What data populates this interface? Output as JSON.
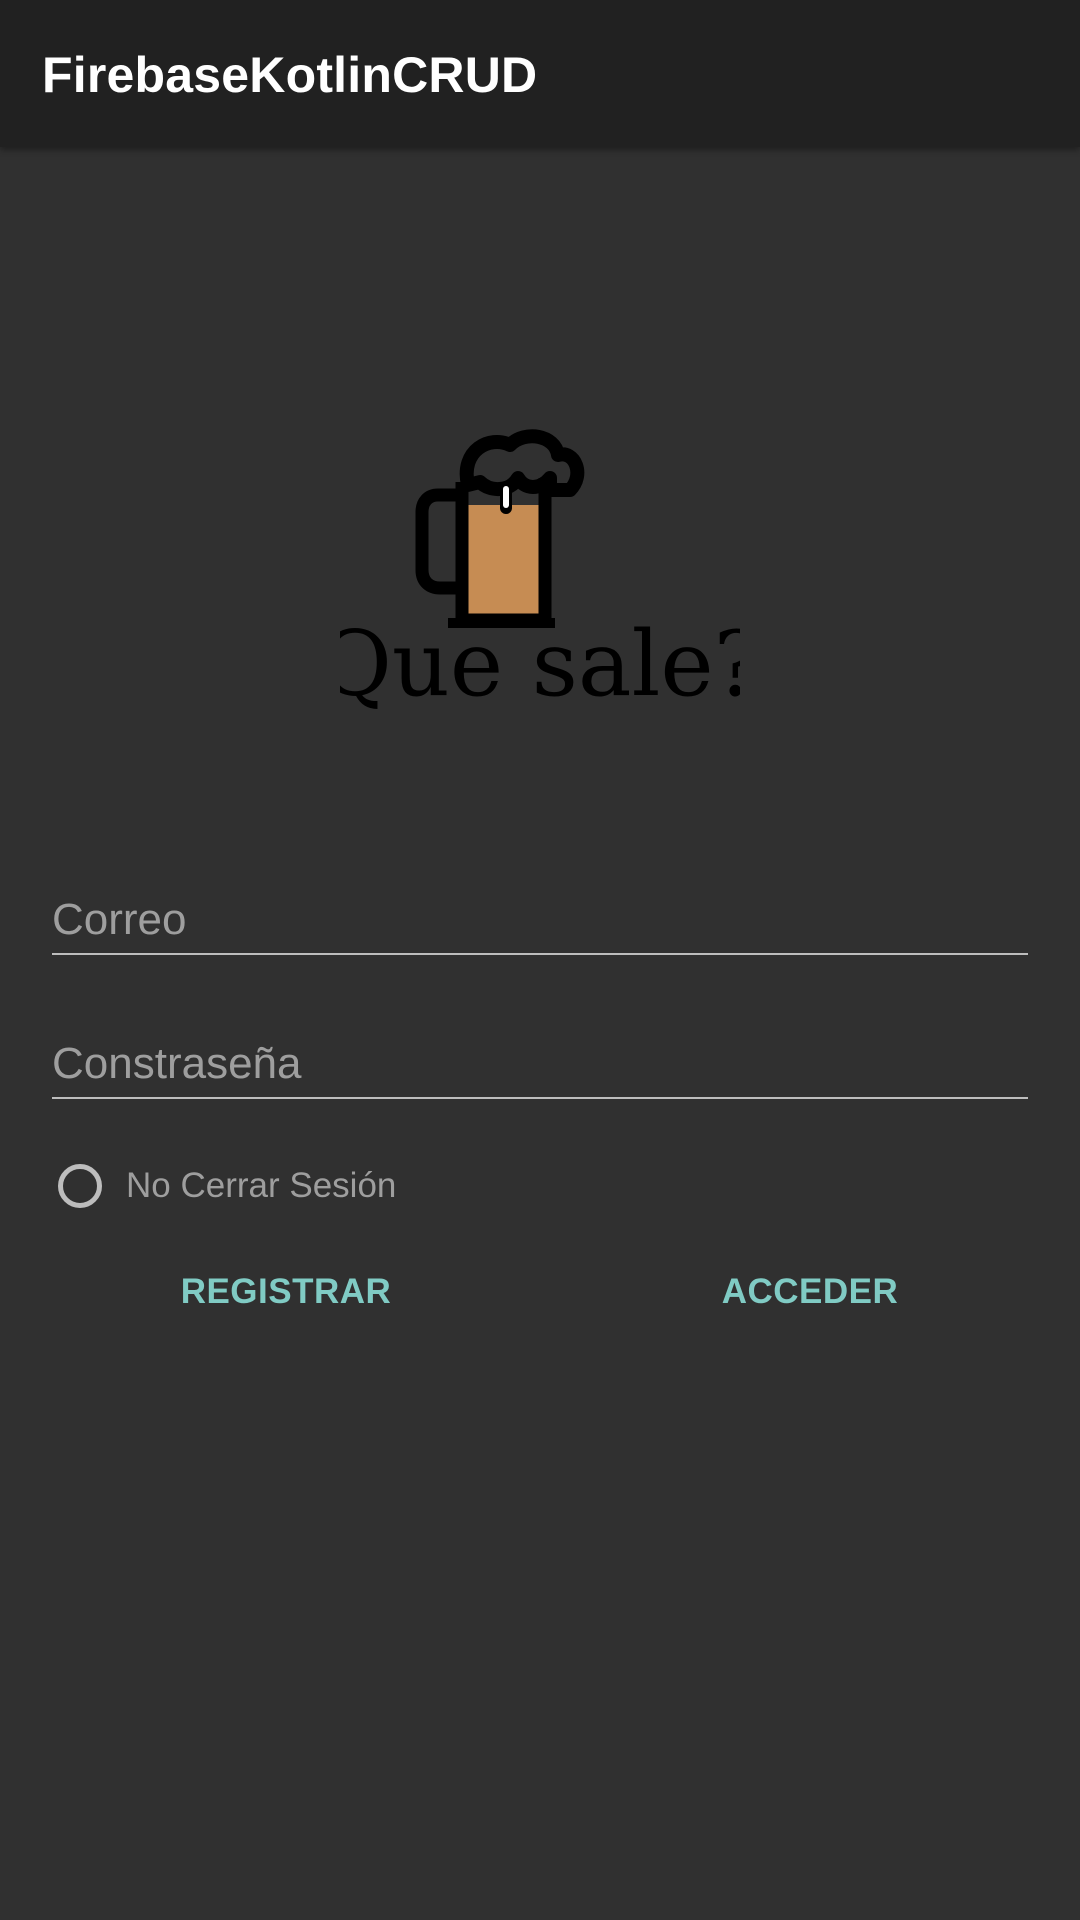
{
  "app_bar": {
    "title": "FirebaseKotlinCRUD"
  },
  "logo": {
    "icon": "beer-mug-icon",
    "text": "Que sale?",
    "colors": {
      "beer": "#c68c53",
      "outline": "#000000",
      "foam": "#ffffff"
    }
  },
  "form": {
    "email": {
      "value": "",
      "placeholder": "Correo"
    },
    "password": {
      "value": "",
      "placeholder": "Constraseña"
    },
    "keep_session": {
      "label": "No Cerrar Sesión",
      "checked": false
    }
  },
  "actions": {
    "register_label": "REGISTRAR",
    "login_label": "ACCEDER"
  },
  "colors": {
    "background": "#303030",
    "app_bar": "#212121",
    "accent": "#80cbc4",
    "hint": "#9e9e9e",
    "underline": "#bdbdbd"
  }
}
